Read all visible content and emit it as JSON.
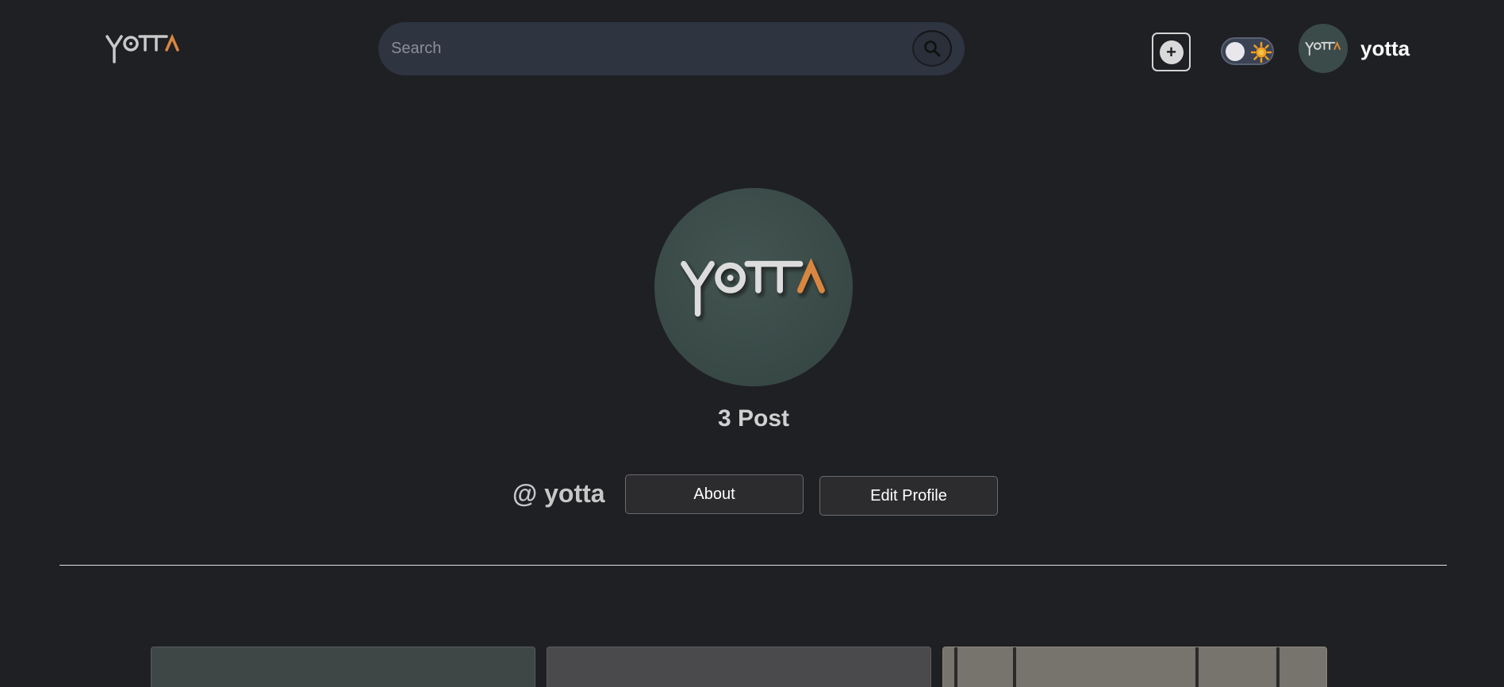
{
  "header": {
    "logo_text": "YOTTA",
    "search": {
      "placeholder": "Search",
      "value": ""
    },
    "icons": {
      "search": "search-icon",
      "add": "plus-circle-icon",
      "theme": "sun-icon"
    },
    "theme_toggle": {
      "state": "off"
    },
    "username": "yotta"
  },
  "profile": {
    "avatar_logo": "YOTTA",
    "post_count_label": "3 Post",
    "handle": "@ yotta",
    "about_label": "About",
    "edit_profile_label": "Edit Profile"
  },
  "posts": [
    {
      "color": "#3e4745"
    },
    {
      "color": "#4a4a4c"
    },
    {
      "color": "#76746c"
    }
  ],
  "colors": {
    "background": "#1f2024",
    "search_bg": "#2e3440",
    "accent_orange": "#d9863f",
    "logo_gray": "#c9c9c9",
    "avatar_bg": "#3b4b49"
  }
}
